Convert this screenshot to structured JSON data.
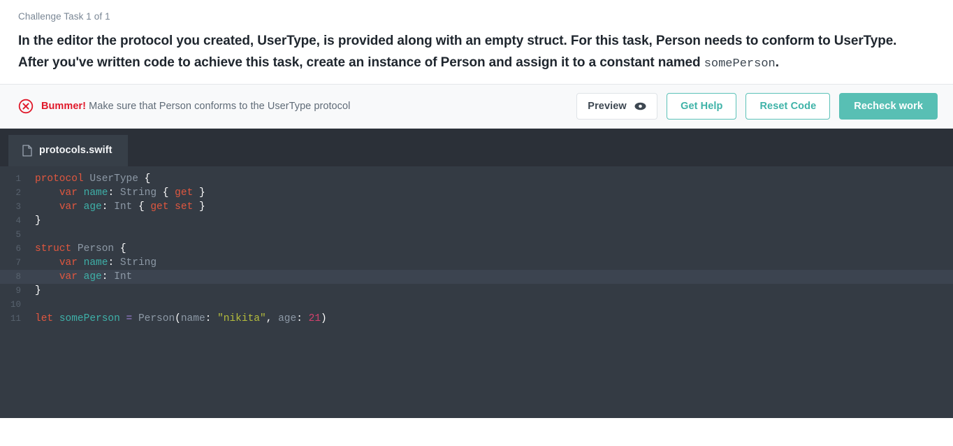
{
  "task": {
    "counter": "Challenge Task 1 of 1",
    "paragraph1_part1": "In the editor the protocol you created, UserType, is provided along with an empty struct. For this task, Person needs to conform to UserType.",
    "paragraph2_part1": "After you've written code to achieve this task, create an instance of Person and assign it to a constant named ",
    "paragraph2_code": "somePerson",
    "paragraph2_part2": "."
  },
  "status": {
    "icon": "error-circle-x-icon",
    "prefix": "Bummer!",
    "message": " Make sure that Person conforms to the UserType protocol",
    "error_color": "#e0192a"
  },
  "buttons": {
    "preview": "Preview",
    "preview_icon": "eye-icon",
    "get_help": "Get Help",
    "reset_code": "Reset Code",
    "recheck_work": "Recheck work",
    "accent_color": "#58bfb4"
  },
  "editor": {
    "file_icon": "file-document-icon",
    "tab_name": "protocols.swift",
    "background": "#343b44",
    "active_line": 8,
    "lines": [
      {
        "n": "1",
        "tokens": [
          {
            "t": "kw",
            "v": "protocol"
          },
          {
            "t": "plain",
            "v": " "
          },
          {
            "t": "type",
            "v": "UserType"
          },
          {
            "t": "plain",
            "v": " "
          },
          {
            "t": "punc",
            "v": "{"
          }
        ]
      },
      {
        "n": "2",
        "tokens": [
          {
            "t": "plain",
            "v": "    "
          },
          {
            "t": "kw",
            "v": "var"
          },
          {
            "t": "plain",
            "v": " "
          },
          {
            "t": "id",
            "v": "name"
          },
          {
            "t": "punc",
            "v": ":"
          },
          {
            "t": "plain",
            "v": " "
          },
          {
            "t": "type",
            "v": "String"
          },
          {
            "t": "plain",
            "v": " "
          },
          {
            "t": "punc",
            "v": "{"
          },
          {
            "t": "plain",
            "v": " "
          },
          {
            "t": "kw",
            "v": "get"
          },
          {
            "t": "plain",
            "v": " "
          },
          {
            "t": "punc",
            "v": "}"
          }
        ]
      },
      {
        "n": "3",
        "tokens": [
          {
            "t": "plain",
            "v": "    "
          },
          {
            "t": "kw",
            "v": "var"
          },
          {
            "t": "plain",
            "v": " "
          },
          {
            "t": "id",
            "v": "age"
          },
          {
            "t": "punc",
            "v": ":"
          },
          {
            "t": "plain",
            "v": " "
          },
          {
            "t": "type",
            "v": "Int"
          },
          {
            "t": "plain",
            "v": " "
          },
          {
            "t": "punc",
            "v": "{"
          },
          {
            "t": "plain",
            "v": " "
          },
          {
            "t": "kw",
            "v": "get"
          },
          {
            "t": "plain",
            "v": " "
          },
          {
            "t": "kw",
            "v": "set"
          },
          {
            "t": "plain",
            "v": " "
          },
          {
            "t": "punc",
            "v": "}"
          }
        ]
      },
      {
        "n": "4",
        "tokens": [
          {
            "t": "punc",
            "v": "}"
          }
        ]
      },
      {
        "n": "5",
        "tokens": []
      },
      {
        "n": "6",
        "tokens": [
          {
            "t": "kw",
            "v": "struct"
          },
          {
            "t": "plain",
            "v": " "
          },
          {
            "t": "type",
            "v": "Person"
          },
          {
            "t": "plain",
            "v": " "
          },
          {
            "t": "punc",
            "v": "{"
          }
        ]
      },
      {
        "n": "7",
        "tokens": [
          {
            "t": "plain",
            "v": "    "
          },
          {
            "t": "kw",
            "v": "var"
          },
          {
            "t": "plain",
            "v": " "
          },
          {
            "t": "id",
            "v": "name"
          },
          {
            "t": "punc",
            "v": ":"
          },
          {
            "t": "plain",
            "v": " "
          },
          {
            "t": "type",
            "v": "String"
          }
        ]
      },
      {
        "n": "8",
        "tokens": [
          {
            "t": "plain",
            "v": "    "
          },
          {
            "t": "kw",
            "v": "var"
          },
          {
            "t": "plain",
            "v": " "
          },
          {
            "t": "id",
            "v": "age"
          },
          {
            "t": "punc",
            "v": ":"
          },
          {
            "t": "plain",
            "v": " "
          },
          {
            "t": "type",
            "v": "Int"
          }
        ]
      },
      {
        "n": "9",
        "tokens": [
          {
            "t": "punc",
            "v": "}"
          }
        ]
      },
      {
        "n": "10",
        "tokens": []
      },
      {
        "n": "11",
        "tokens": [
          {
            "t": "kw",
            "v": "let"
          },
          {
            "t": "plain",
            "v": " "
          },
          {
            "t": "id",
            "v": "somePerson"
          },
          {
            "t": "plain",
            "v": " "
          },
          {
            "t": "op",
            "v": "="
          },
          {
            "t": "plain",
            "v": " "
          },
          {
            "t": "type",
            "v": "Person"
          },
          {
            "t": "punc",
            "v": "("
          },
          {
            "t": "plain",
            "v": "name"
          },
          {
            "t": "punc",
            "v": ":"
          },
          {
            "t": "plain",
            "v": " "
          },
          {
            "t": "str",
            "v": "\"nikita\""
          },
          {
            "t": "punc",
            "v": ","
          },
          {
            "t": "plain",
            "v": " age"
          },
          {
            "t": "punc",
            "v": ":"
          },
          {
            "t": "plain",
            "v": " "
          },
          {
            "t": "num",
            "v": "21"
          },
          {
            "t": "punc",
            "v": ")"
          }
        ]
      }
    ]
  }
}
